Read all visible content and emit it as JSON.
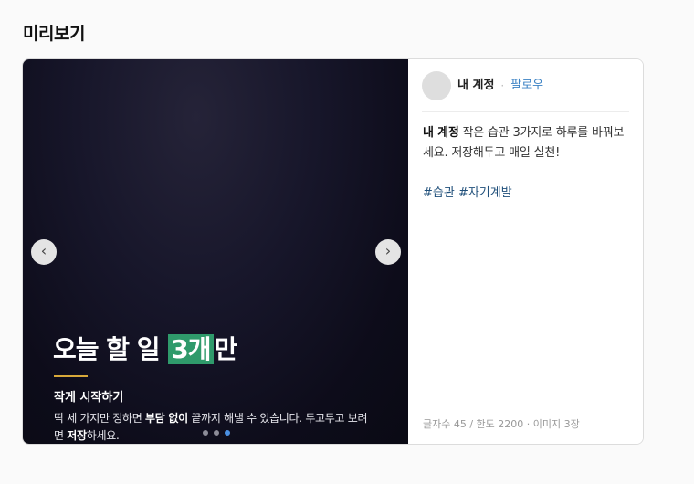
{
  "section": {
    "title": "미리보기"
  },
  "slide": {
    "headline_before": "오늘 할 일 ",
    "headline_highlight": "3개",
    "headline_after": "만",
    "subtitle": "작게 시작하기",
    "body_1": "딱 세 가지만 정하면 ",
    "body_bold_1": "부담 없이",
    "body_2": " 끝까지 해낼 수 있습니다. 두고두고 보려면 ",
    "body_bold_2": "저장",
    "body_3": "하세요.",
    "prev_label": "‹",
    "next_label": "›",
    "dots_count": 3,
    "active_dot": 3,
    "accent_color": "#2f9a6b",
    "rule_color": "#d8a93a"
  },
  "post": {
    "username": "내 계정",
    "separator": "·",
    "follow_label": "팔로우",
    "caption_user": "내 계정",
    "caption_text": " 작은 습관 3가지로 하루를 바꿔보세요. 저장해두고 매일 실천!",
    "hashtags": "#습관 #자기계발",
    "meta": "글자수 45 / 한도 2200 · 이미지 3장",
    "link_color": "#3b82c4"
  }
}
